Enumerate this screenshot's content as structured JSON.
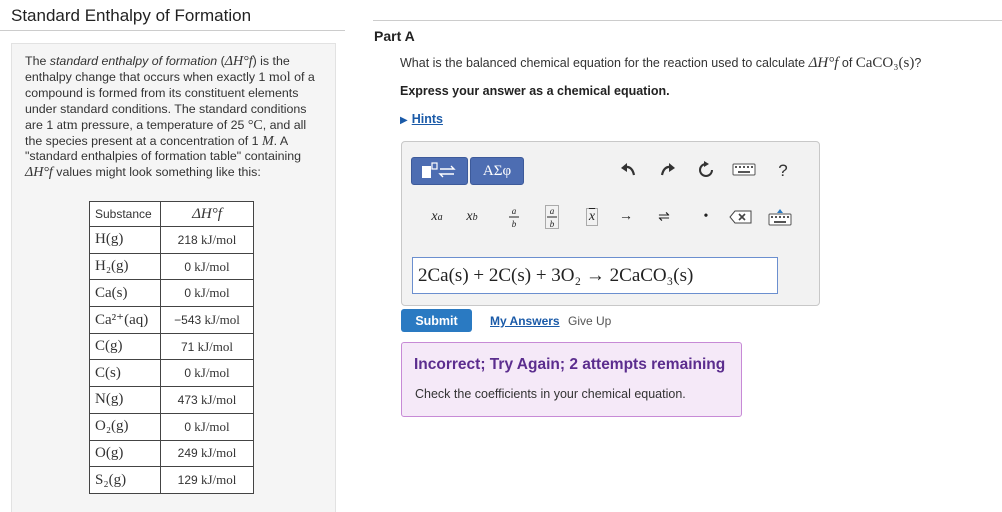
{
  "page": {
    "title": "Standard Enthalpy of Formation"
  },
  "intro": {
    "t1": "The ",
    "t2": "standard enthalpy of formation",
    "t3": " (",
    "sym1": "ΔH°f",
    "t4": ") is the enthalpy change that occurs when exactly 1 ",
    "unit_mol": "mol",
    "t5": " of a compound is formed from its constituent elements under standard conditions. The standard conditions are 1 ",
    "unit_atm": "atm",
    "t6": " pressure, a temperature of 25 ",
    "unit_c": "°C",
    "t7": ", and all the species present at a concentration of 1 ",
    "unit_m": "M",
    "t8": ". A \"standard enthalpies of formation table\" containing ",
    "sym2": "ΔH°f",
    "t9": " values might look something like this:"
  },
  "table": {
    "header_substance": "Substance",
    "header_value": "ΔH°f",
    "rows": [
      {
        "substance": "H(g)",
        "num": "218",
        "unit": " kJ/mol"
      },
      {
        "substance": "H₂(g)",
        "num": "0",
        "unit": " kJ/mol"
      },
      {
        "substance": "Ca(s)",
        "num": "0",
        "unit": " kJ/mol"
      },
      {
        "substance": "Ca²⁺(aq)",
        "num": "−543",
        "unit": " kJ/mol"
      },
      {
        "substance": "C(g)",
        "num": "71",
        "unit": " kJ/mol"
      },
      {
        "substance": "C(s)",
        "num": "0",
        "unit": " kJ/mol"
      },
      {
        "substance": "N(g)",
        "num": "473",
        "unit": " kJ/mol"
      },
      {
        "substance": "O₂(g)",
        "num": "0",
        "unit": " kJ/mol"
      },
      {
        "substance": "O(g)",
        "num": "249",
        "unit": " kJ/mol"
      },
      {
        "substance": "S₂(g)",
        "num": "129",
        "unit": " kJ/mol"
      }
    ]
  },
  "part": {
    "label": "Part A",
    "question_pre": "What is the balanced chemical equation for the reaction used to calculate ",
    "question_sym": "ΔH°f",
    "question_mid": " of ",
    "question_compound": "CaCO₃(s)",
    "question_post": "?",
    "instruction": "Express your answer as a chemical equation.",
    "hints_label": "Hints"
  },
  "editor": {
    "greek_label": "ΑΣφ",
    "help_label": "?",
    "answer": "2Ca(s) + 2C(s) + 3O₂ → 2CaCO₃(s)"
  },
  "actions": {
    "submit_label": "Submit",
    "my_answers_label": "My Answers",
    "give_up_label": "Give Up"
  },
  "feedback": {
    "title": "Incorrect; Try Again; 2 attempts remaining",
    "text": "Check the coefficients in your chemical equation."
  },
  "colors": {
    "accent_blue": "#2a7ac2",
    "toolbar_blue": "#4d6db2",
    "feedback_bg": "#f5e9f8",
    "feedback_border": "#c78ad6",
    "feedback_title": "#5b2d8e"
  }
}
